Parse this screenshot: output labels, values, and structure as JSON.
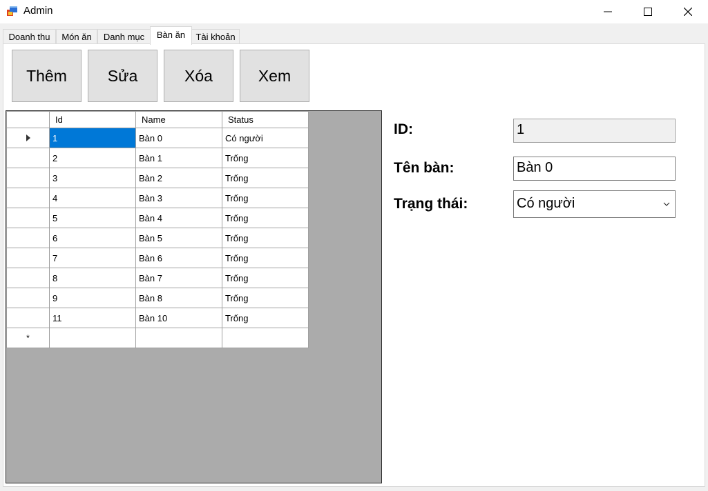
{
  "window": {
    "title": "Admin",
    "app_icon": "windows-form-icon"
  },
  "tabs": [
    {
      "label": "Doanh thu",
      "active": false
    },
    {
      "label": "Món ăn",
      "active": false
    },
    {
      "label": "Danh mục",
      "active": false
    },
    {
      "label": "Bàn ăn",
      "active": true
    },
    {
      "label": "Tài khoản",
      "active": false
    }
  ],
  "toolbar": {
    "add_label": "Thêm",
    "edit_label": "Sửa",
    "delete_label": "Xóa",
    "view_label": "Xem"
  },
  "grid": {
    "columns": [
      "Id",
      "Name",
      "Status"
    ],
    "rows": [
      {
        "id": "1",
        "name": "Bàn 0",
        "status": "Có người"
      },
      {
        "id": "2",
        "name": "Bàn 1",
        "status": "Trống"
      },
      {
        "id": "3",
        "name": "Bàn 2",
        "status": "Trống"
      },
      {
        "id": "4",
        "name": "Bàn 3",
        "status": "Trống"
      },
      {
        "id": "5",
        "name": "Bàn 4",
        "status": "Trống"
      },
      {
        "id": "6",
        "name": "Bàn 5",
        "status": "Trống"
      },
      {
        "id": "7",
        "name": "Bàn 6",
        "status": "Trống"
      },
      {
        "id": "8",
        "name": "Bàn 7",
        "status": "Trống"
      },
      {
        "id": "9",
        "name": "Bàn 8",
        "status": "Trống"
      },
      {
        "id": "11",
        "name": "Bàn 10",
        "status": "Trống"
      }
    ],
    "selected_row": 0,
    "new_row_marker": "*"
  },
  "form": {
    "id_label": "ID:",
    "id_value": "1",
    "name_label": "Tên bàn:",
    "name_value": "Bàn 0",
    "status_label": "Trạng thái:",
    "status_value": "Có người"
  },
  "colors": {
    "selection": "#0078d7",
    "grid_background": "#ababab",
    "button_face": "#e1e1e1"
  }
}
